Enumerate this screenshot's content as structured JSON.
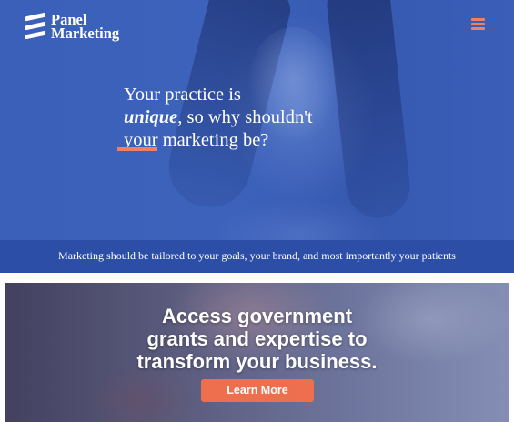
{
  "header": {
    "logo": {
      "line1": "Panel",
      "line2": "Marketing"
    },
    "menu_icon": "hamburger-menu-icon"
  },
  "hero": {
    "headline_line1": "Your practice is",
    "headline_emphasis": "unique",
    "headline_line2_rest": ", so why shouldn't",
    "headline_line3": "your marketing be?",
    "tagline": "Marketing should be tailored to your goals, your brand, and most importantly your patients"
  },
  "promo": {
    "heading_line1": "Access government",
    "heading_line2": "grants and expertise to",
    "heading_line3": "transform your business.",
    "cta_label": "Learn More"
  },
  "colors": {
    "hero_blue": "#3a60b9",
    "tagline_bar": "#2d4ea6",
    "accent_coral": "#f07f64",
    "cta_orange": "#ee6f4d"
  }
}
